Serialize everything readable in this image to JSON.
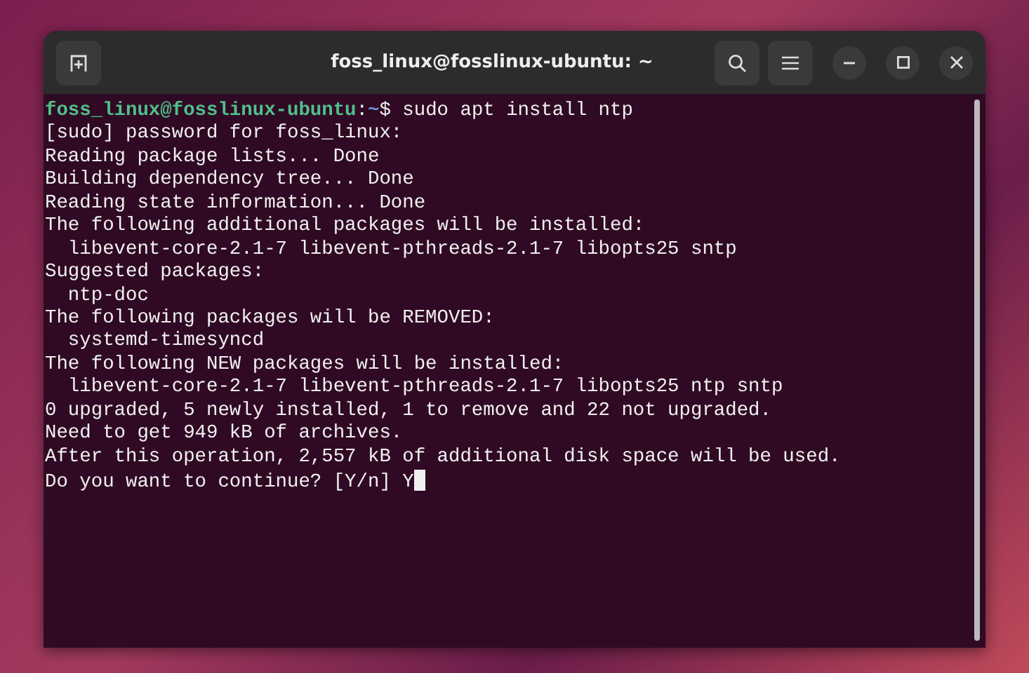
{
  "window": {
    "title": "foss_linux@fosslinux-ubuntu: ~"
  },
  "prompt": {
    "user_host": "foss_linux@fosslinux-ubuntu",
    "separator": ":",
    "path": "~",
    "symbol": "$",
    "command": "sudo apt install ntp"
  },
  "output": [
    "[sudo] password for foss_linux:",
    "Reading package lists... Done",
    "Building dependency tree... Done",
    "Reading state information... Done",
    "The following additional packages will be installed:",
    "  libevent-core-2.1-7 libevent-pthreads-2.1-7 libopts25 sntp",
    "Suggested packages:",
    "  ntp-doc",
    "The following packages will be REMOVED:",
    "  systemd-timesyncd",
    "The following NEW packages will be installed:",
    "  libevent-core-2.1-7 libevent-pthreads-2.1-7 libopts25 ntp sntp",
    "0 upgraded, 5 newly installed, 1 to remove and 22 not upgraded.",
    "Need to get 949 kB of archives.",
    "After this operation, 2,557 kB of additional disk space will be used."
  ],
  "question": {
    "text": "Do you want to continue? [Y/n]",
    "answer": "Y"
  }
}
